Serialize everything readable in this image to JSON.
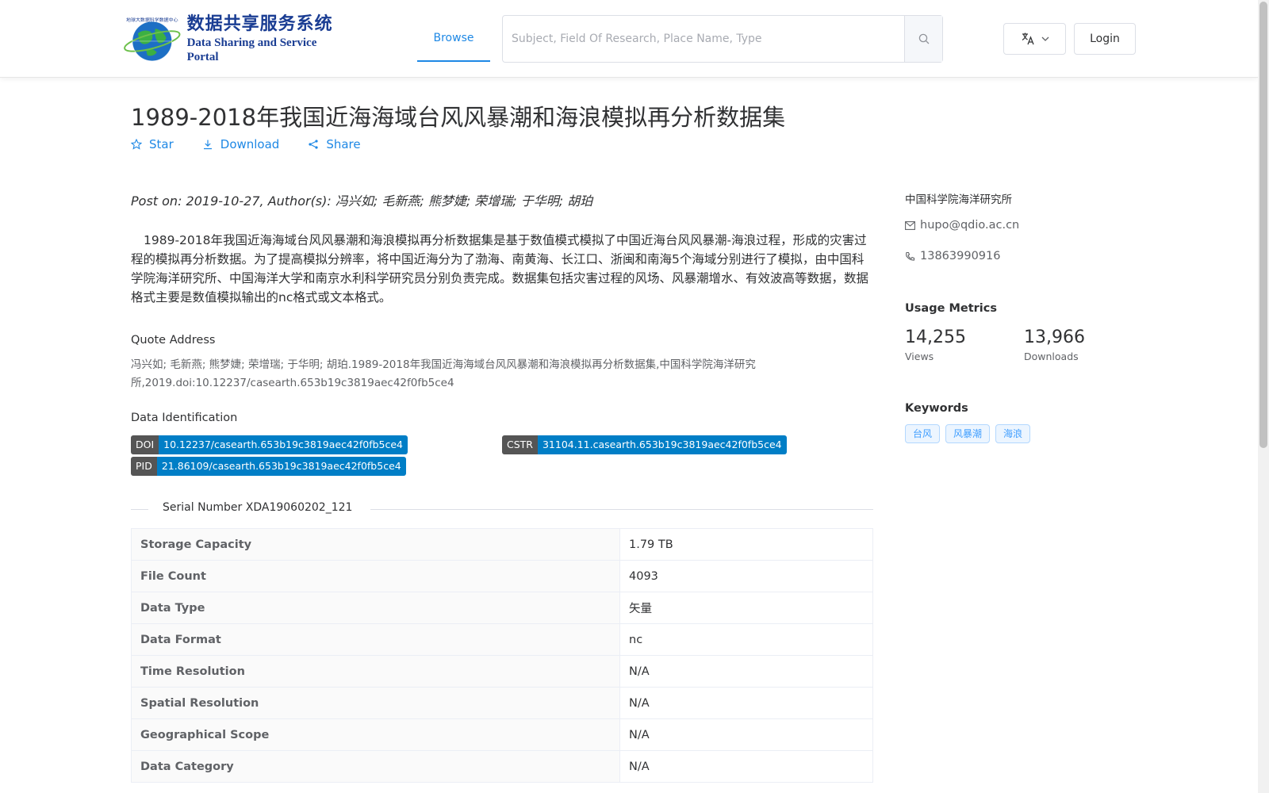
{
  "header": {
    "logo_cn": "数据共享服务系统",
    "logo_en": "Data Sharing and Service Portal",
    "logo_ring_text": "地球大数据科学数据中心",
    "nav_browse": "Browse",
    "search_placeholder": "Subject, Field Of Research, Place Name, Type",
    "login_label": "Login"
  },
  "dataset": {
    "title": "1989-2018年我国近海海域台风风暴潮和海浪模拟再分析数据集",
    "actions": {
      "star": "Star",
      "download": "Download",
      "share": "Share"
    },
    "post_line": "Post on: 2019-10-27, Author(s): 冯兴如; 毛新燕; 熊梦婕; 荣增瑞; 于华明; 胡珀",
    "description": "1989-2018年我国近海海域台风风暴潮和海浪模拟再分析数据集是基于数值模式模拟了中国近海台风风暴潮-海浪过程，形成的灾害过程的模拟再分析数据。为了提高模拟分辨率，将中国近海分为了渤海、南黄海、长江口、浙闽和南海5个海域分别进行了模拟，由中国科学院海洋研究所、中国海洋大学和南京水利科学研究员分别负责完成。数据集包括灾害过程的风场、风暴潮增水、有效波高等数据，数据格式主要是数值模拟输出的nc格式或文本格式。",
    "quote_label": "Quote Address",
    "quote_text": "冯兴如; 毛新燕; 熊梦婕; 荣增瑞; 于华明; 胡珀.1989-2018年我国近海海域台风风暴潮和海浪模拟再分析数据集,中国科学院海洋研究所,2019.doi:10.12237/casearth.653b19c3819aec42f0fb5ce4",
    "identification_label": "Data Identification",
    "identifiers": {
      "doi": {
        "key": "DOI",
        "value": "10.12237/casearth.653b19c3819aec42f0fb5ce4"
      },
      "cstr": {
        "key": "CSTR",
        "value": "31104.11.casearth.653b19c3819aec42f0fb5ce4"
      },
      "pid": {
        "key": "PID",
        "value": "21.86109/casearth.653b19c3819aec42f0fb5ce4"
      }
    },
    "serial_number": "Serial Number XDA19060202_121",
    "properties": [
      {
        "label": "Storage Capacity",
        "value": "1.79 TB"
      },
      {
        "label": "File Count",
        "value": "4093"
      },
      {
        "label": "Data Type",
        "value": "矢量"
      },
      {
        "label": "Data Format",
        "value": "nc"
      },
      {
        "label": "Time Resolution",
        "value": "N/A"
      },
      {
        "label": "Spatial Resolution",
        "value": "N/A"
      },
      {
        "label": "Geographical Scope",
        "value": "N/A"
      },
      {
        "label": "Data Category",
        "value": "N/A"
      }
    ]
  },
  "sidebar": {
    "organization": "中国科学院海洋研究所",
    "email": "hupo@qdio.ac.cn",
    "phone": "13863990916",
    "usage_heading": "Usage Metrics",
    "views_value": "14,255",
    "views_label": "Views",
    "downloads_value": "13,966",
    "downloads_label": "Downloads",
    "keywords_heading": "Keywords",
    "keywords": [
      "台风",
      "风暴潮",
      "海浪"
    ]
  },
  "colors": {
    "accent": "#1e88e5",
    "logo_blue": "#1a3d93",
    "badge_key": "#555555",
    "badge_value": "#007ec6"
  }
}
